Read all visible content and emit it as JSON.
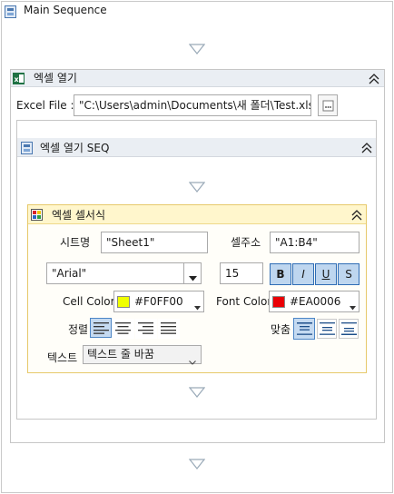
{
  "main": {
    "title": "Main Sequence"
  },
  "excel_open": {
    "title": "엑셀 열기",
    "file_label": "Excel File :",
    "file_value": "\"C:\\Users\\admin\\Documents\\새 폴더\\Test.xlsx\""
  },
  "seq": {
    "title": "엑셀 열기 SEQ"
  },
  "format": {
    "title": "엑셀 셀서식",
    "sheet_label": "시트명",
    "sheet_value": "\"Sheet1\"",
    "address_label": "셀주소",
    "address_value": "\"A1:B4\"",
    "font_value": "\"Arial\"",
    "font_size": "15",
    "bold_label": "B",
    "italic_label": "I",
    "underline_label": "U",
    "strike_label": "S",
    "cell_color_label": "Cell Color",
    "cell_color_value": "#F0FF00",
    "font_color_label": "Font Color",
    "font_color_value": "#EA0006",
    "align_label": "정렬",
    "fit_label": "맞춤",
    "text_label": "텍스트",
    "text_option": "텍스트 줄 바꿈"
  },
  "colors": {
    "cell_swatch": "#F0FF00",
    "font_swatch": "#EA0006",
    "accent": "#2f6db5"
  }
}
